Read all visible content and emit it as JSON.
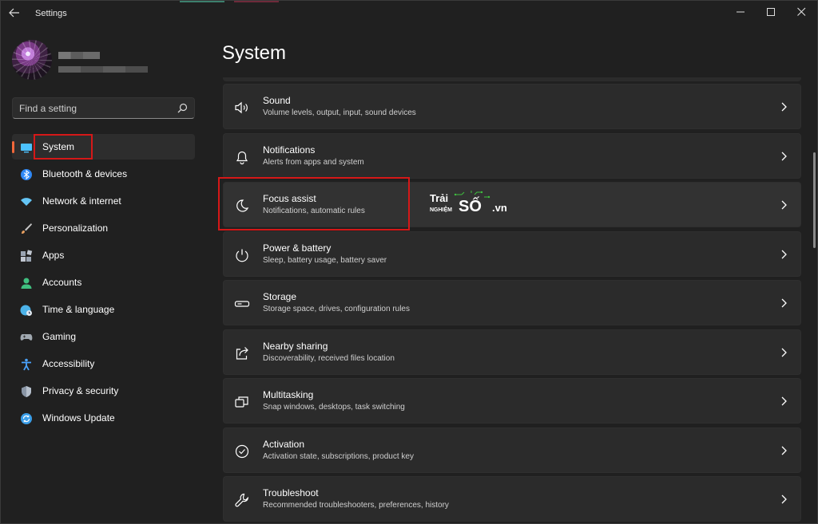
{
  "window": {
    "title": "Settings",
    "accent_colors": [
      "#3c7f6d",
      "#6e2a3a",
      "#2f3a60"
    ]
  },
  "search": {
    "placeholder": "Find a setting"
  },
  "sidebar": {
    "items": [
      {
        "label": "System",
        "icon": "monitor-icon",
        "color": "#4cc2ff",
        "active": true
      },
      {
        "label": "Bluetooth & devices",
        "icon": "bluetooth-icon",
        "color": "#2f88f5"
      },
      {
        "label": "Network & internet",
        "icon": "wifi-icon",
        "color": "#64c5f5"
      },
      {
        "label": "Personalization",
        "icon": "brush-icon",
        "color": "#e8a060"
      },
      {
        "label": "Apps",
        "icon": "apps-icon",
        "color": "#9aa4b2"
      },
      {
        "label": "Accounts",
        "icon": "person-icon",
        "color": "#3fbf7f"
      },
      {
        "label": "Time & language",
        "icon": "globe-clock-icon",
        "color": "#4cb2e8"
      },
      {
        "label": "Gaming",
        "icon": "gamepad-icon",
        "color": "#a0a8b0"
      },
      {
        "label": "Accessibility",
        "icon": "accessibility-icon",
        "color": "#4aa3ff"
      },
      {
        "label": "Privacy & security",
        "icon": "shield-icon",
        "color": "#8a96a6"
      },
      {
        "label": "Windows Update",
        "icon": "update-icon",
        "color": "#3a9ee8"
      }
    ]
  },
  "main": {
    "title": "System",
    "cards": [
      {
        "title": "Sound",
        "subtitle": "Volume levels, output, input, sound devices",
        "icon": "speaker-icon"
      },
      {
        "title": "Notifications",
        "subtitle": "Alerts from apps and system",
        "icon": "bell-icon"
      },
      {
        "title": "Focus assist",
        "subtitle": "Notifications, automatic rules",
        "icon": "moon-icon"
      },
      {
        "title": "Power & battery",
        "subtitle": "Sleep, battery usage, battery saver",
        "icon": "power-icon"
      },
      {
        "title": "Storage",
        "subtitle": "Storage space, drives, configuration rules",
        "icon": "storage-icon"
      },
      {
        "title": "Nearby sharing",
        "subtitle": "Discoverability, received files location",
        "icon": "share-icon"
      },
      {
        "title": "Multitasking",
        "subtitle": "Snap windows, desktops, task switching",
        "icon": "multitask-icon"
      },
      {
        "title": "Activation",
        "subtitle": "Activation state, subscriptions, product key",
        "icon": "check-circle-icon"
      },
      {
        "title": "Troubleshoot",
        "subtitle": "Recommended troubleshooters, preferences, history",
        "icon": "wrench-icon"
      }
    ]
  },
  "watermark": {
    "line1": "Trải",
    "line2": "NGHIỆM",
    "line3": "SỐ",
    "line4": ".vn"
  },
  "highlight_color": "#d51818"
}
